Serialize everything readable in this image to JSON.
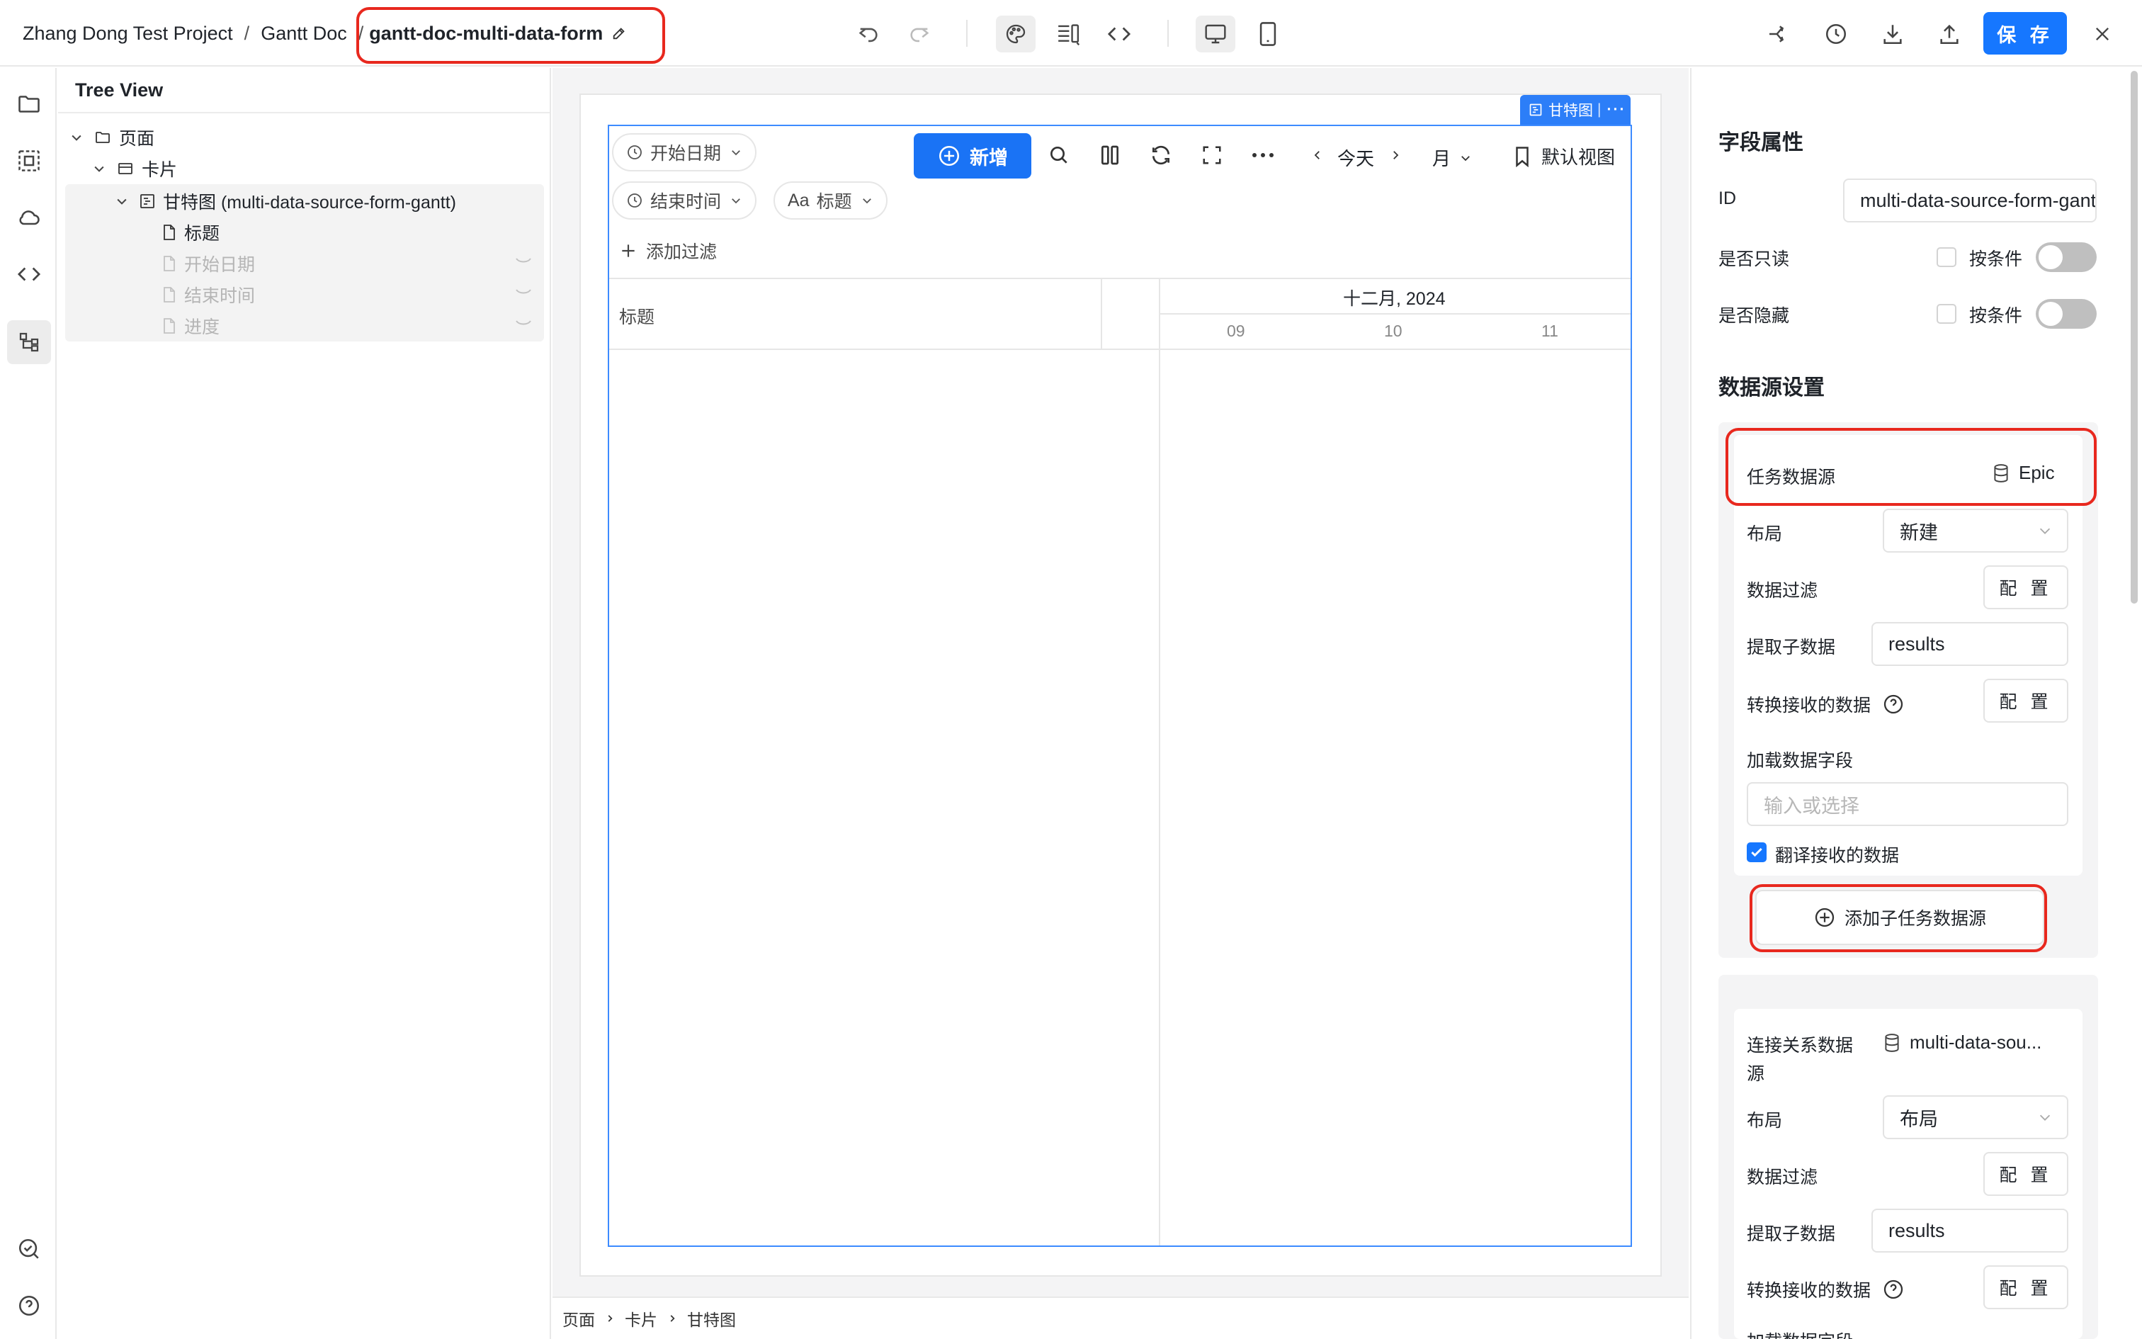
{
  "header": {
    "project": "Zhang Dong Test Project",
    "separator": "/",
    "section": "Gantt Doc",
    "current_doc": "gantt-doc-multi-data-form",
    "save_label": "保 存"
  },
  "tree": {
    "title": "Tree View",
    "nodes": [
      {
        "label": "页面"
      },
      {
        "label": "卡片"
      },
      {
        "label": "甘特图 (multi-data-source-form-gantt)"
      },
      {
        "label": "标题"
      },
      {
        "label": "开始日期"
      },
      {
        "label": "结束时间"
      },
      {
        "label": "进度"
      }
    ]
  },
  "gantt": {
    "selection_tag": "甘特图",
    "selection_tag_divider": "|",
    "selection_tag_more": "···",
    "filters": [
      "开始日期",
      "结束时间",
      "标题"
    ],
    "title_prefix": "Aa",
    "add_button": "新增",
    "today": "今天",
    "view_unit": "月",
    "default_view": "默认视图",
    "add_filter": "添加过滤",
    "column_title": "标题",
    "month_label": "十二月, 2024",
    "days": [
      "09",
      "10",
      "11"
    ]
  },
  "footer": {
    "breadcrumb": [
      "页面",
      "卡片",
      "甘特图"
    ]
  },
  "props": {
    "section_title": "字段属性",
    "id_label": "ID",
    "id_value": "multi-data-source-form-gantt",
    "readonly_label": "是否只读",
    "hidden_label": "是否隐藏",
    "by_condition": "按条件",
    "ds_section_title": "数据源设置",
    "task_ds_label": "任务数据源",
    "task_ds_value": "Epic",
    "layout_label": "布局",
    "layout_value": "新建",
    "filter_label": "数据过滤",
    "config_label": "配 置",
    "extract_label": "提取子数据",
    "extract_value": "results",
    "transform_label": "转换接收的数据",
    "load_fields_label": "加载数据字段",
    "load_fields_placeholder": "输入或选择",
    "translate_label": "翻译接收的数据",
    "add_sub_ds": "添加子任务数据源",
    "link_ds_label_1": "连接关系数据",
    "link_ds_label_2": "源",
    "link_ds_value": "multi-data-sou...",
    "layout_value_2": "布局",
    "extract_value_2": "results",
    "load_fields_label_2": "加载数据字段"
  },
  "colors": {
    "accent": "#1677ff",
    "highlight": "#e8281e",
    "selection": "#3d8bff"
  }
}
